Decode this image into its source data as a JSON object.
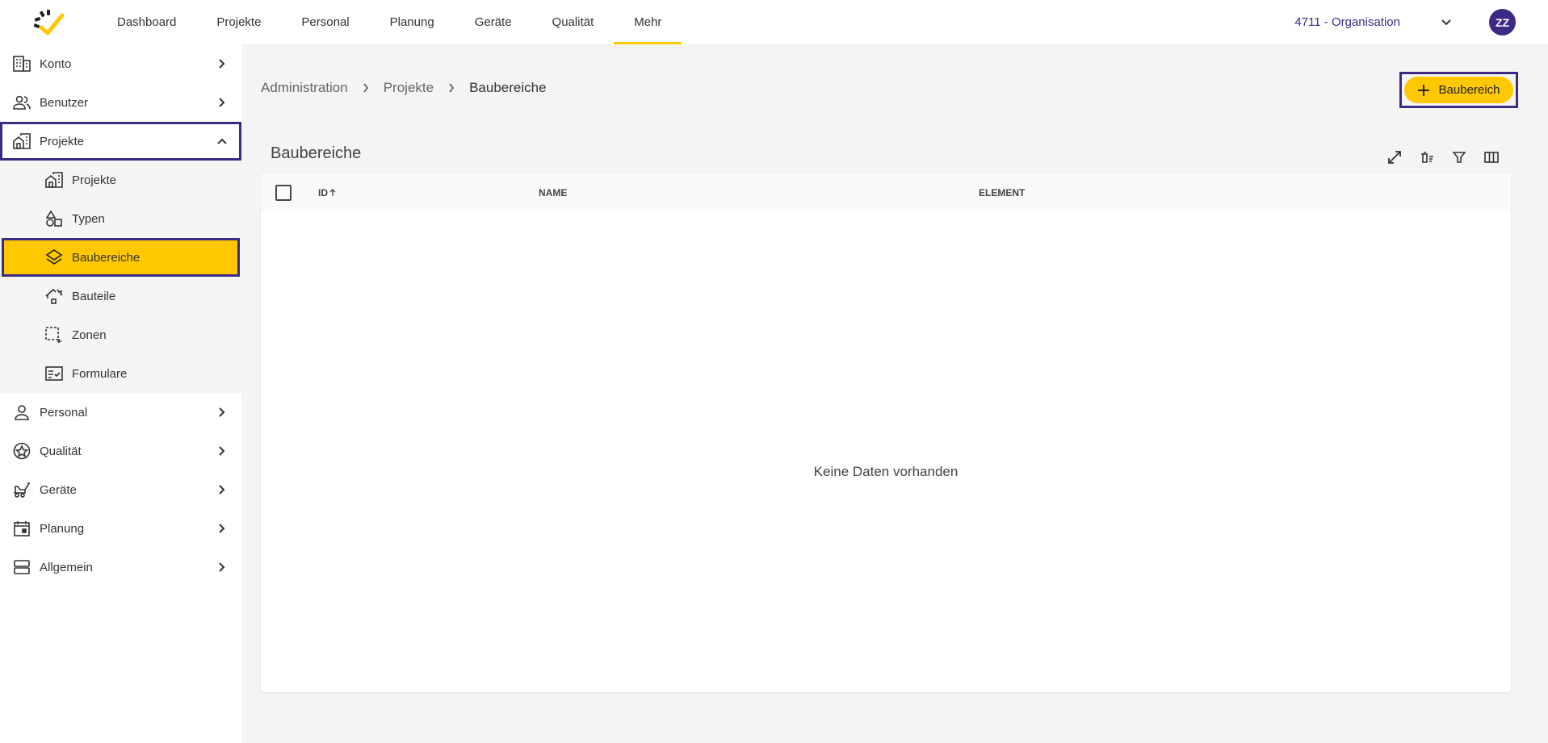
{
  "topnav": {
    "items": [
      {
        "label": "Dashboard"
      },
      {
        "label": "Projekte"
      },
      {
        "label": "Personal"
      },
      {
        "label": "Planung"
      },
      {
        "label": "Geräte"
      },
      {
        "label": "Qualität"
      },
      {
        "label": "Mehr"
      }
    ],
    "active": "Mehr",
    "organization": "4711 - Organisation",
    "avatar_initials": "ZZ"
  },
  "sidebar": {
    "items": [
      {
        "label": "Konto",
        "icon": "building-icon"
      },
      {
        "label": "Benutzer",
        "icon": "users-icon"
      },
      {
        "label": "Projekte",
        "icon": "home-building-icon",
        "expanded": true
      },
      {
        "label": "Personal",
        "icon": "person-icon"
      },
      {
        "label": "Qualität",
        "icon": "quality-icon"
      },
      {
        "label": "Geräte",
        "icon": "equipment-icon"
      },
      {
        "label": "Planung",
        "icon": "calendar-icon"
      },
      {
        "label": "Allgemein",
        "icon": "stack-icon"
      }
    ],
    "sub_items": [
      {
        "label": "Projekte",
        "icon": "home-building-icon"
      },
      {
        "label": "Typen",
        "icon": "shapes-icon"
      },
      {
        "label": "Baubereiche",
        "icon": "layers-icon",
        "selected": true
      },
      {
        "label": "Bauteile",
        "icon": "house-part-icon"
      },
      {
        "label": "Zonen",
        "icon": "zone-icon"
      },
      {
        "label": "Formulare",
        "icon": "form-icon"
      }
    ]
  },
  "breadcrumb": {
    "items": [
      "Administration",
      "Projekte",
      "Baubereiche"
    ]
  },
  "add_button": {
    "label": "Baubereich"
  },
  "table": {
    "title": "Baubereiche",
    "columns": [
      "ID",
      "NAME",
      "ELEMENT"
    ],
    "sort_column": "ID",
    "sort_direction": "asc",
    "empty_text": "Keine Daten vorhanden"
  },
  "colors": {
    "accent": "#ffc800",
    "brand": "#3d2a84"
  }
}
